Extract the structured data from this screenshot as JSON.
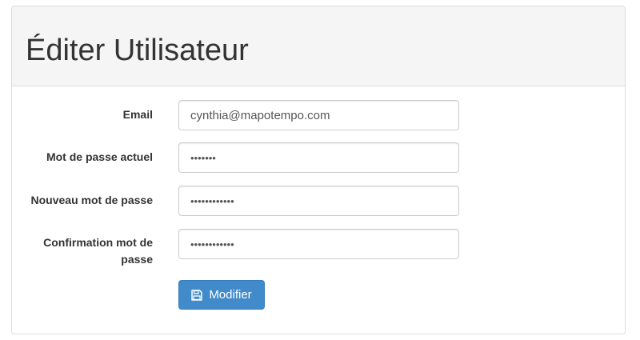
{
  "page": {
    "title": "Éditer Utilisateur"
  },
  "form": {
    "email": {
      "label": "Email",
      "value": "cynthia@mapotempo.com"
    },
    "current_password": {
      "label": "Mot de passe actuel",
      "value": "1234567"
    },
    "new_password": {
      "label": "Nouveau mot de passe",
      "value": "123456789012"
    },
    "password_confirmation": {
      "label": "Confirmation mot de passe",
      "value": "123456789012"
    },
    "submit": {
      "label": "Modifier",
      "icon": "save-icon"
    }
  },
  "colors": {
    "primary": "#428bca",
    "heading_bg": "#f5f5f5"
  }
}
